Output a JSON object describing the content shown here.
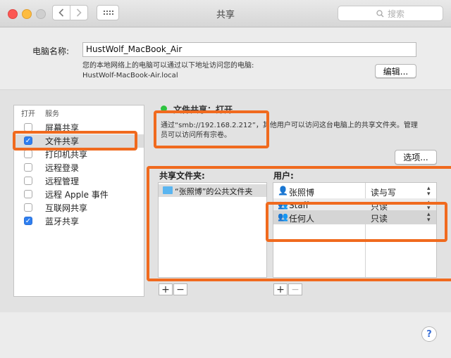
{
  "window": {
    "title": "共享"
  },
  "toolbar": {
    "back_icon": "chevron-left-icon",
    "forward_icon": "chevron-right-icon",
    "grid_icon": "grid-icon",
    "search_placeholder": "搜索"
  },
  "computer_name": {
    "label": "电脑名称:",
    "value": "HustWolf_MacBook_Air",
    "desc_line1": "您的本地网络上的电脑可以通过以下地址访问您的电脑:",
    "desc_line2": "HustWolf-MacBook-Air.local",
    "edit_label": "编辑..."
  },
  "services": {
    "header_on": "打开",
    "header_service": "服务",
    "items": [
      {
        "label": "屏幕共享",
        "checked": false
      },
      {
        "label": "文件共享",
        "checked": true
      },
      {
        "label": "打印机共享",
        "checked": false
      },
      {
        "label": "远程登录",
        "checked": false
      },
      {
        "label": "远程管理",
        "checked": false
      },
      {
        "label": "远程 Apple 事件",
        "checked": false
      },
      {
        "label": "互联网共享",
        "checked": false
      },
      {
        "label": "蓝牙共享",
        "checked": true
      }
    ]
  },
  "status": {
    "text": "文件共享：打开",
    "desc_line1": "通过“smb://192.168.2.212”，其他用户可以访问这台电脑上的共享文件夹。管理",
    "desc_line2": "员可以访问所有宗卷。",
    "color": "#2ec33f"
  },
  "options_label": "选项...",
  "shared_folders": {
    "header": "共享文件夹:",
    "items": [
      {
        "label": "“张照博”的公共文件夹"
      }
    ]
  },
  "users": {
    "header": "用户:",
    "rows": [
      {
        "name": "张照博",
        "permission": "读与写"
      },
      {
        "name": "Staff",
        "permission": "只读"
      },
      {
        "name": "任何人",
        "permission": "只读"
      }
    ]
  },
  "buttons": {
    "add": "+",
    "remove": "−",
    "help": "?"
  },
  "annotation_color": "#f06a1e"
}
